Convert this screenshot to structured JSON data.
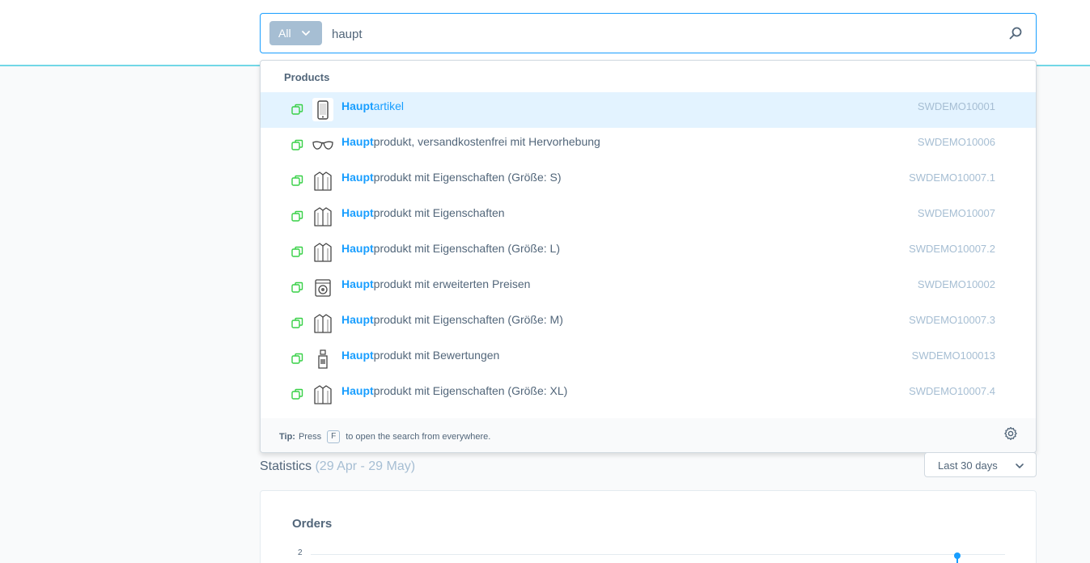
{
  "search": {
    "type_filter": "All",
    "query": "haupt",
    "search_icon": "search-icon"
  },
  "results": {
    "group_title": "Products",
    "items": [
      {
        "highlight": "Haupt",
        "rest": "artikel",
        "number": "SWDEMO10001",
        "icon": "phone-icon",
        "active": true
      },
      {
        "highlight": "Haupt",
        "rest": "produkt, versandkostenfrei mit Hervorhebung",
        "number": "SWDEMO10006",
        "icon": "sunglasses-icon",
        "active": false
      },
      {
        "highlight": "Haupt",
        "rest": "produkt mit Eigenschaften (Größe: S)",
        "number": "SWDEMO10007.1",
        "icon": "jacket-icon",
        "active": false
      },
      {
        "highlight": "Haupt",
        "rest": "produkt mit Eigenschaften",
        "number": "SWDEMO10007",
        "icon": "jacket-icon",
        "active": false
      },
      {
        "highlight": "Haupt",
        "rest": "produkt mit Eigenschaften (Größe: L)",
        "number": "SWDEMO10007.2",
        "icon": "jacket-icon",
        "active": false
      },
      {
        "highlight": "Haupt",
        "rest": "produkt mit erweiterten Preisen",
        "number": "SWDEMO10002",
        "icon": "washing-machine-icon",
        "active": false
      },
      {
        "highlight": "Haupt",
        "rest": "produkt mit Eigenschaften (Größe: M)",
        "number": "SWDEMO10007.3",
        "icon": "jacket-icon",
        "active": false
      },
      {
        "highlight": "Haupt",
        "rest": "produkt mit Bewertungen",
        "number": "SWDEMO100013",
        "icon": "spray-bottle-icon",
        "active": false
      },
      {
        "highlight": "Haupt",
        "rest": "produkt mit Eigenschaften (Größe: XL)",
        "number": "SWDEMO10007.4",
        "icon": "jacket-icon",
        "active": false
      }
    ]
  },
  "footer": {
    "tip_label": "Tip:",
    "tip_before": "Press",
    "tip_key": "F",
    "tip_after": "to open the search from everywhere."
  },
  "statistics": {
    "title": "Statistics",
    "range": "(29 Apr - 29 May)",
    "period": "Last 30 days"
  },
  "orders_card": {
    "title": "Orders",
    "y_tick": "2"
  },
  "colors": {
    "accent": "#189eff",
    "muted": "#a6bed3",
    "copy_icon": "#37d046",
    "topbar_border": "#72d7e6"
  }
}
